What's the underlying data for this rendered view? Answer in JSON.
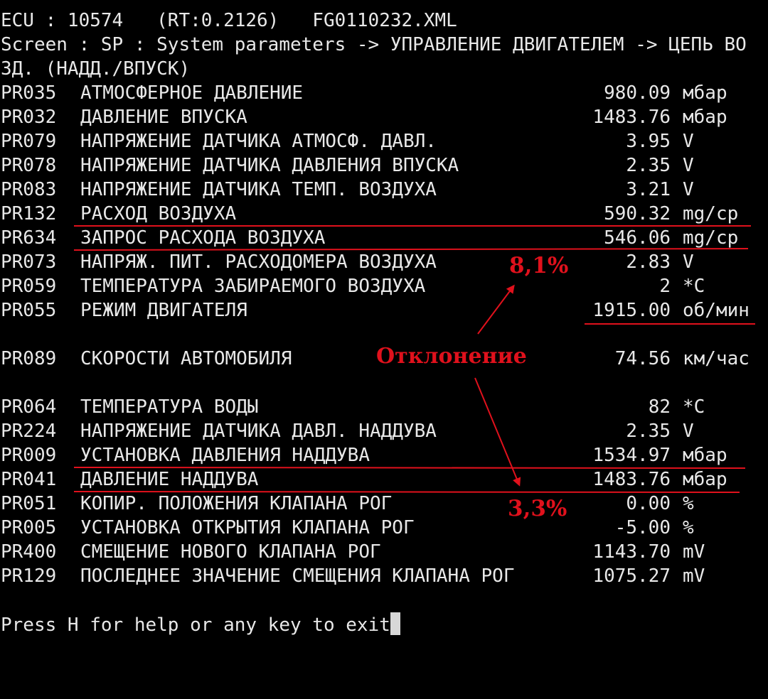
{
  "header": {
    "line1": "ECU : 10574   (RT:0.2126)   FG0110232.XML",
    "line2": "Screen : SP : System parameters -> УПРАВЛЕНИЕ ДВИГАТЕЛЕМ -> ЦЕПЬ ВО",
    "line3": "ЗД. (НАДД./ВПУСК)"
  },
  "params": [
    {
      "code": "PR035",
      "label": "АТМОСФЕРНОЕ ДАВЛЕНИЕ",
      "value": "980.09",
      "unit": "мбар"
    },
    {
      "code": "PR032",
      "label": "ДАВЛЕНИЕ ВПУСКА",
      "value": "1483.76",
      "unit": "мбар"
    },
    {
      "code": "PR079",
      "label": "НАПРЯЖЕНИЕ ДАТЧИКА АТМОСФ. ДАВЛ.",
      "value": "3.95",
      "unit": "V"
    },
    {
      "code": "PR078",
      "label": "НАПРЯЖЕНИЕ ДАТЧИКА ДАВЛЕНИЯ ВПУСКА",
      "value": "2.35",
      "unit": "V"
    },
    {
      "code": "PR083",
      "label": "НАПРЯЖЕНИЕ ДАТЧИКА ТЕМП. ВОЗДУХА",
      "value": "3.21",
      "unit": "V"
    },
    {
      "code": "PR132",
      "label": "РАСХОД ВОЗДУХА",
      "value": "590.32",
      "unit": "mg/cp"
    },
    {
      "code": "PR634",
      "label": "ЗАПРОС РАСХОДА ВОЗДУХА",
      "value": "546.06",
      "unit": "mg/cp"
    },
    {
      "code": "PR073",
      "label": "НАПРЯЖ. ПИТ. РАСХОДОМЕРА ВОЗДУХА",
      "value": "2.83",
      "unit": "V"
    },
    {
      "code": "PR059",
      "label": "ТЕМПЕРАТУРА ЗАБИРАЕМОГО ВОЗДУХА",
      "value": "2",
      "unit": "*C"
    },
    {
      "code": "PR055",
      "label": "РЕЖИМ ДВИГАТЕЛЯ",
      "value": "1915.00",
      "unit": "об/мин"
    },
    {
      "code": "PR089",
      "label": "СКОРОСТИ АВТОМОБИЛЯ",
      "value": "74.56",
      "unit": "км/час"
    },
    {
      "code": "PR064",
      "label": "ТЕМПЕРАТУРА ВОДЫ",
      "value": "82",
      "unit": "*C"
    },
    {
      "code": "PR224",
      "label": "НАПРЯЖЕНИЕ ДАТЧИКА ДАВЛ. НАДДУВА",
      "value": "2.35",
      "unit": "V"
    },
    {
      "code": "PR009",
      "label": "УСТАНОВКА ДАВЛЕНИЯ НАДДУВА",
      "value": "1534.97",
      "unit": "мбар"
    },
    {
      "code": "PR041",
      "label": "ДАВЛЕНИЕ НАДДУВА",
      "value": "1483.76",
      "unit": "мбар"
    },
    {
      "code": "PR051",
      "label": "КОПИР. ПОЛОЖЕНИЯ КЛАПАНА РОГ",
      "value": "0.00",
      "unit": "%"
    },
    {
      "code": "PR005",
      "label": "УСТАНОВКА ОТКРЫТИЯ КЛАПАНА РОГ",
      "value": "-5.00",
      "unit": "%"
    },
    {
      "code": "PR400",
      "label": "СМЕЩЕНИЕ НОВОГО КЛАПАНА РОГ",
      "value": "1143.70",
      "unit": "mV"
    },
    {
      "code": "PR129",
      "label": "ПОСЛЕДНЕЕ ЗНАЧЕНИЕ СМЕЩЕНИЯ КЛАПАНА РОГ",
      "value": "1075.27",
      "unit": "mV"
    }
  ],
  "footer": {
    "prompt": "Press H for help or any key to exit"
  },
  "annotations": {
    "deviation_label": "Отклонение",
    "air_flow_deviation": "8,1%",
    "boost_deviation": "3,3%",
    "color": "#e0111c"
  }
}
